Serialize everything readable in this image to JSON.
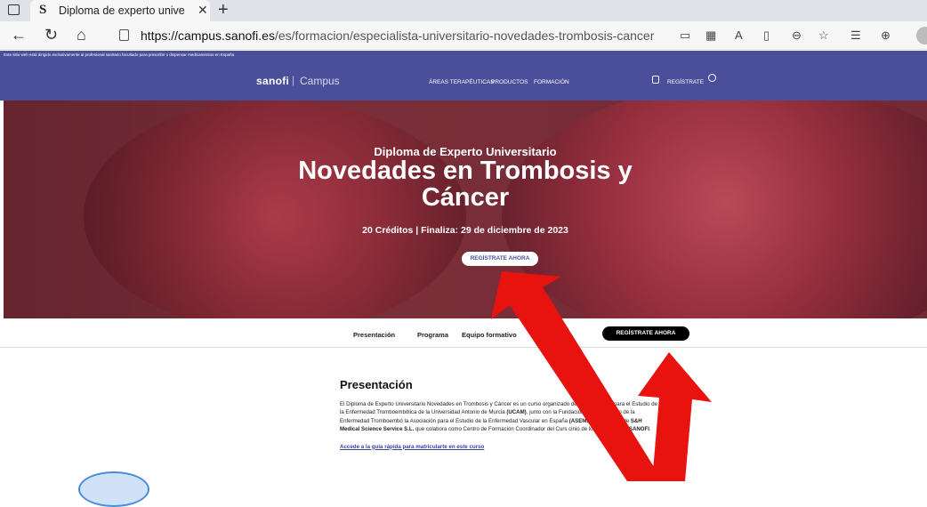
{
  "browser": {
    "tab_title": "Diploma de experto universitario",
    "tab_favicon": "S",
    "tab_close": "✕",
    "new_tab": "+",
    "url_host": "https://campus.sanofi.es",
    "url_path": "/es/formacion/especialista-universitario-novedades-trombosis-cancer"
  },
  "site": {
    "notice": "Este sitio web está dirigido exclusivamente al profesional sanitario facultado para prescribir o dispensar medicamentos en España",
    "logo": "sanofi",
    "logo_sep": "|",
    "logo_campus": "Campus",
    "menu": [
      "ÁREAS TERAPÉUTICAS",
      "PRODUCTOS",
      "FORMACIÓN"
    ],
    "register": "REGÍSTRATE"
  },
  "hero": {
    "subtitle": "Diploma de Experto Universitario",
    "title_line1": "Novedades en Trombosis y",
    "title_line2": "Cáncer",
    "credits": "20 Créditos | Finaliza: 29 de diciembre de 2023",
    "button": "REGÍSTRATE AHORA"
  },
  "subnav": {
    "items": [
      "Presentación",
      "Programa",
      "Equipo formativo"
    ],
    "button": "REGÍSTRATE AHORA"
  },
  "content": {
    "heading": "Presentación",
    "p1": "El Diploma de Experto Universitario Novedades en Trombosis y Cáncer es un curso",
    "p1b": "organizado desde la Cátedra para el Estudio de la Enfermedad Tromboembólica de la Universidad",
    "p1c": "Antonio de Murcia",
    "ucam": "(UCAM)",
    "p2": ", junto con la Fundación para el Estudio de la Enfermedad Tromboembó",
    "p2b": "la Asociación para el Estudio de la Enfermedad Vascular en España",
    "asemeve": "(ASEMEVE)",
    "p3": ", a través de",
    "sh": "S&H Medical Science Service S.L.",
    "p4": "que colabora como Centro de Formación Coordinador del Curs",
    "p4b": "cinio de los Laboratorios",
    "sanofi": "SANOFI",
    "dot": ".",
    "link": "Accede a la guía rápida para matricularte en este curso"
  },
  "colors": {
    "brand": "#4b4f9a",
    "arrow": "#e8120f"
  }
}
